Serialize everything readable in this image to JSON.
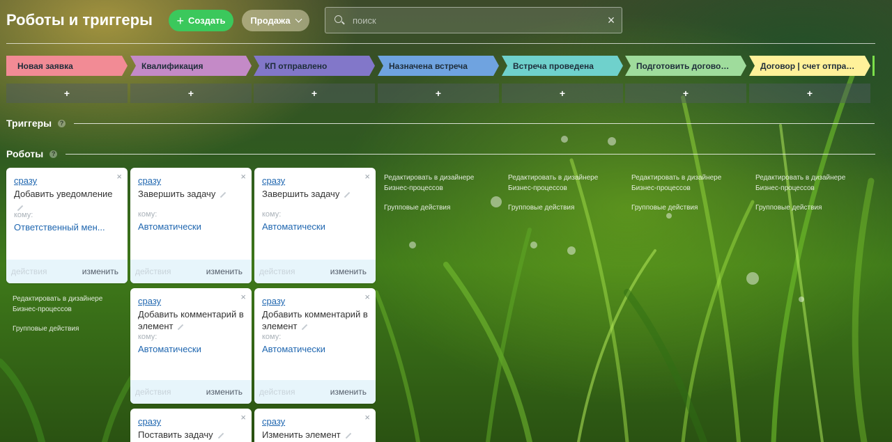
{
  "header": {
    "title": "Роботы и триггеры",
    "create_label": "Создать",
    "category_label": "Продажа",
    "search_placeholder": "поиск",
    "search_value": ""
  },
  "stages": [
    {
      "label": "Новая заявка",
      "color": "#f28b95"
    },
    {
      "label": "Квалификация",
      "color": "#c48ac7"
    },
    {
      "label": "КП отправлено",
      "color": "#8277c9"
    },
    {
      "label": "Назначена встреча",
      "color": "#6fa3e0"
    },
    {
      "label": "Встреча проведена",
      "color": "#6fd1cc"
    },
    {
      "label": "Подготовить договор | ...",
      "color": "#9fdc9c"
    },
    {
      "label": "Договор | счет отправ...",
      "color": "#fff19a"
    }
  ],
  "add_label": "+",
  "sections": {
    "triggers": "Триггеры",
    "robots": "Роботы",
    "help": "?"
  },
  "card_common": {
    "close": "×",
    "actions": "действия",
    "edit": "изменить",
    "to_label": "кому:"
  },
  "cards": [
    {
      "when": "сразу",
      "name": "Добавить уведомление",
      "to": "Ответственный мен..."
    },
    {
      "when": "сразу",
      "name": "Завершить задачу",
      "to": "Автоматически"
    },
    {
      "when": "сразу",
      "name": "Завершить задачу",
      "to": "Автоматически"
    },
    {
      "when": "сразу",
      "name": "Добавить комментарий в элемент",
      "to": "Автоматически"
    },
    {
      "when": "сразу",
      "name": "Добавить комментарий в элемент",
      "to": "Автоматически"
    },
    {
      "when": "сразу",
      "name": "Поставить задачу"
    },
    {
      "when": "сразу",
      "name": "Изменить элемент"
    }
  ],
  "column_links": {
    "designer": "Редактировать в дизайнере Бизнес-процессов",
    "group": "Групповые действия"
  }
}
